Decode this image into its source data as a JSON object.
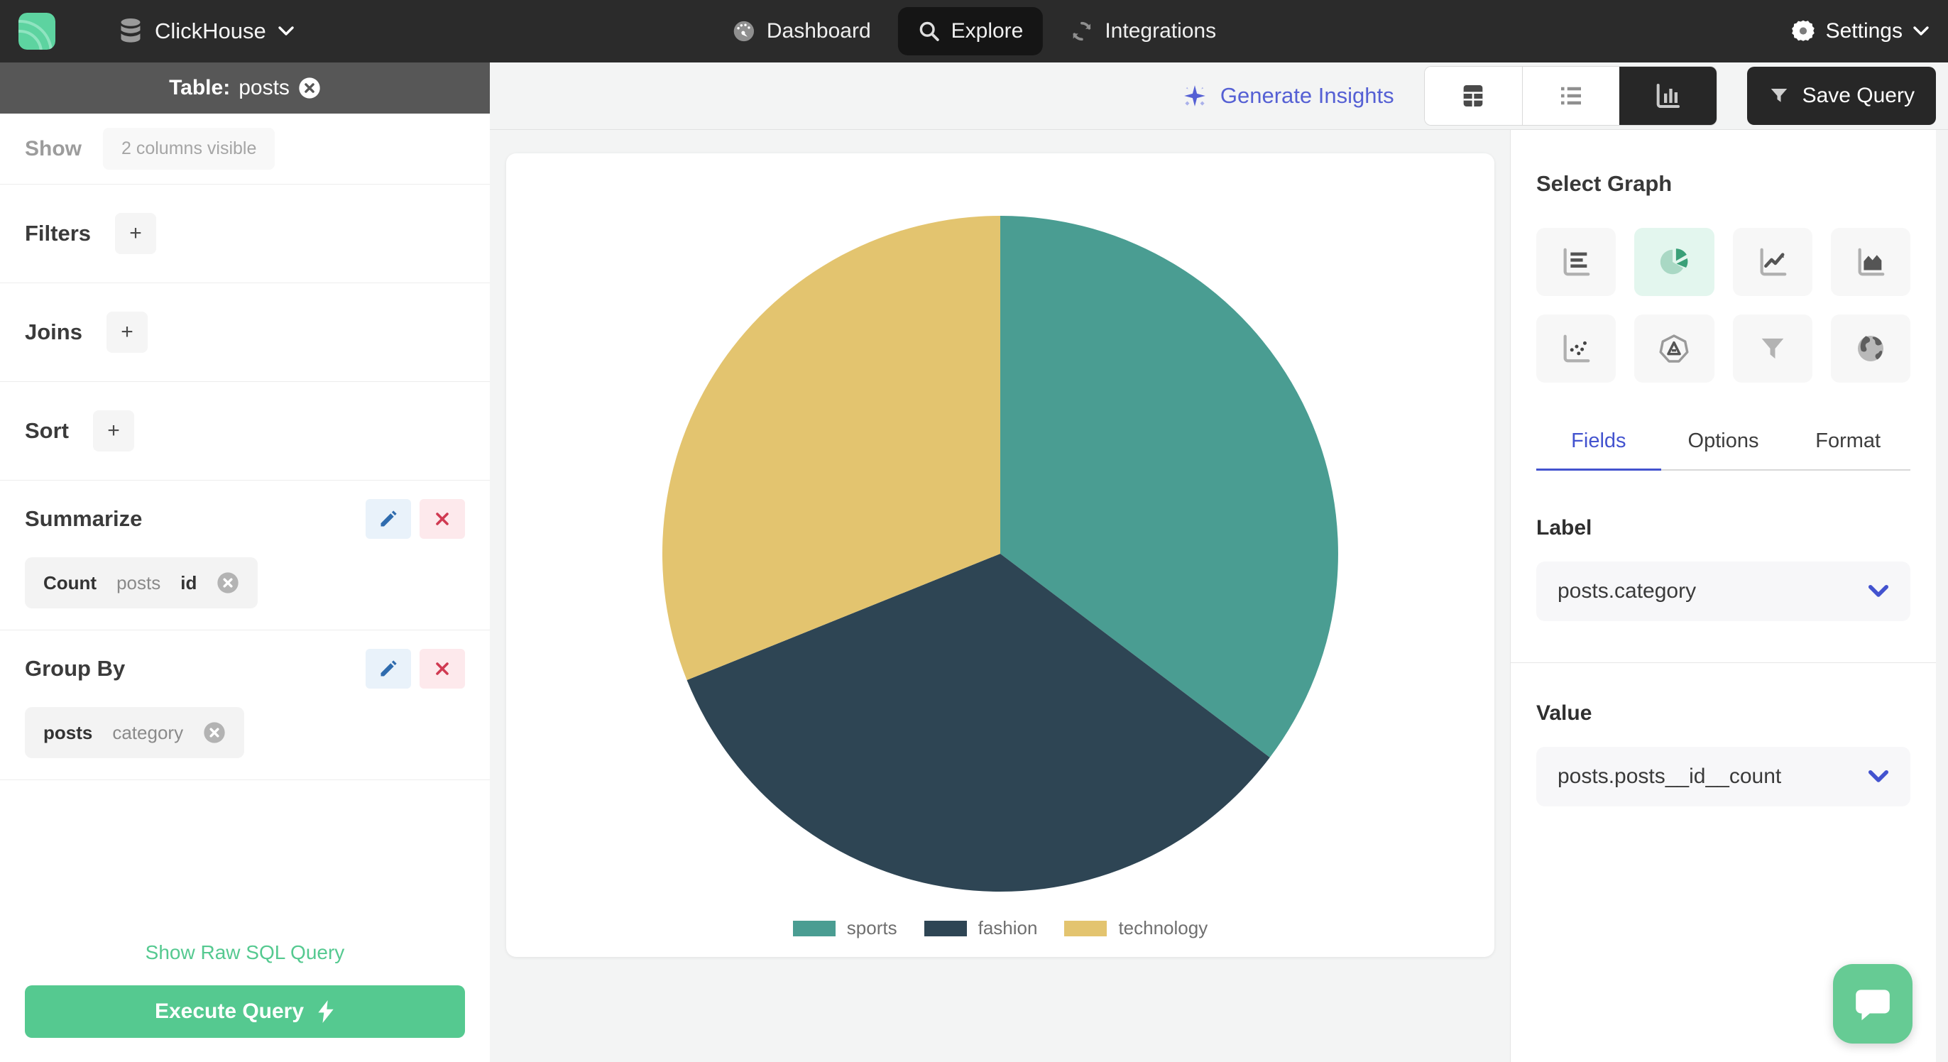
{
  "navbar": {
    "brand": "ClickHouse",
    "nav": [
      {
        "label": "Dashboard",
        "icon": "gauge-icon",
        "active": false
      },
      {
        "label": "Explore",
        "icon": "search-icon",
        "active": true
      },
      {
        "label": "Integrations",
        "icon": "sync-icon",
        "active": false
      }
    ],
    "settings_label": "Settings"
  },
  "sidebar": {
    "table_prefix": "Table:",
    "table_name": "posts",
    "show_label": "Show",
    "show_value": "2 columns visible",
    "plus_label": "+",
    "sections": [
      {
        "label": "Filters"
      },
      {
        "label": "Joins"
      },
      {
        "label": "Sort"
      }
    ],
    "summarize": {
      "title": "Summarize",
      "chip": {
        "agg": "Count",
        "table": "posts",
        "field": "id"
      }
    },
    "group_by": {
      "title": "Group By",
      "chip": {
        "table": "posts",
        "field": "category"
      }
    },
    "raw_sql_link": "Show Raw SQL Query",
    "execute_label": "Execute Query"
  },
  "toolbar": {
    "generate_insights": "Generate Insights",
    "view_toggle": {
      "options": [
        "table-view",
        "list-view",
        "chart-view"
      ],
      "active": "chart-view"
    },
    "save_query": "Save Query"
  },
  "right_panel": {
    "title": "Select Graph",
    "graph_types": [
      {
        "name": "bar-chart",
        "active": false
      },
      {
        "name": "pie-chart",
        "active": true
      },
      {
        "name": "line-chart",
        "active": false
      },
      {
        "name": "area-chart",
        "active": false
      },
      {
        "name": "scatter-plot",
        "active": false
      },
      {
        "name": "radar-chart",
        "active": false
      },
      {
        "name": "funnel-chart",
        "active": false
      },
      {
        "name": "map-chart",
        "active": false
      }
    ],
    "tabs": [
      "Fields",
      "Options",
      "Format"
    ],
    "active_tab": "Fields",
    "label_heading": "Label",
    "label_value": "posts.category",
    "value_heading": "Value",
    "value_value": "posts.posts__id__count"
  },
  "chart_data": {
    "type": "pie",
    "labels": [
      "sports",
      "fashion",
      "technology"
    ],
    "values": [
      35.3,
      33.6,
      31.1
    ],
    "values_note": "percent of circle, estimated from slice angles (127°, 121°, 112°); no numeric data labels shown",
    "colors": [
      "#4a9d92",
      "#2e4554",
      "#e3c46f"
    ],
    "start_angle_deg": 0,
    "direction": "clockwise",
    "legend_position": "bottom"
  },
  "colors": {
    "accent_green": "#55c990",
    "accent_blue": "#4353cf",
    "insights_blue": "#5560d4",
    "navbar_bg": "#2b2b2b",
    "sidebar_header_bg": "#575757",
    "active_graph_bg": "#e3f6ee",
    "edit_blue": "#2f6cae",
    "delete_red": "#d03a52",
    "chat_green": "#66cb94"
  }
}
